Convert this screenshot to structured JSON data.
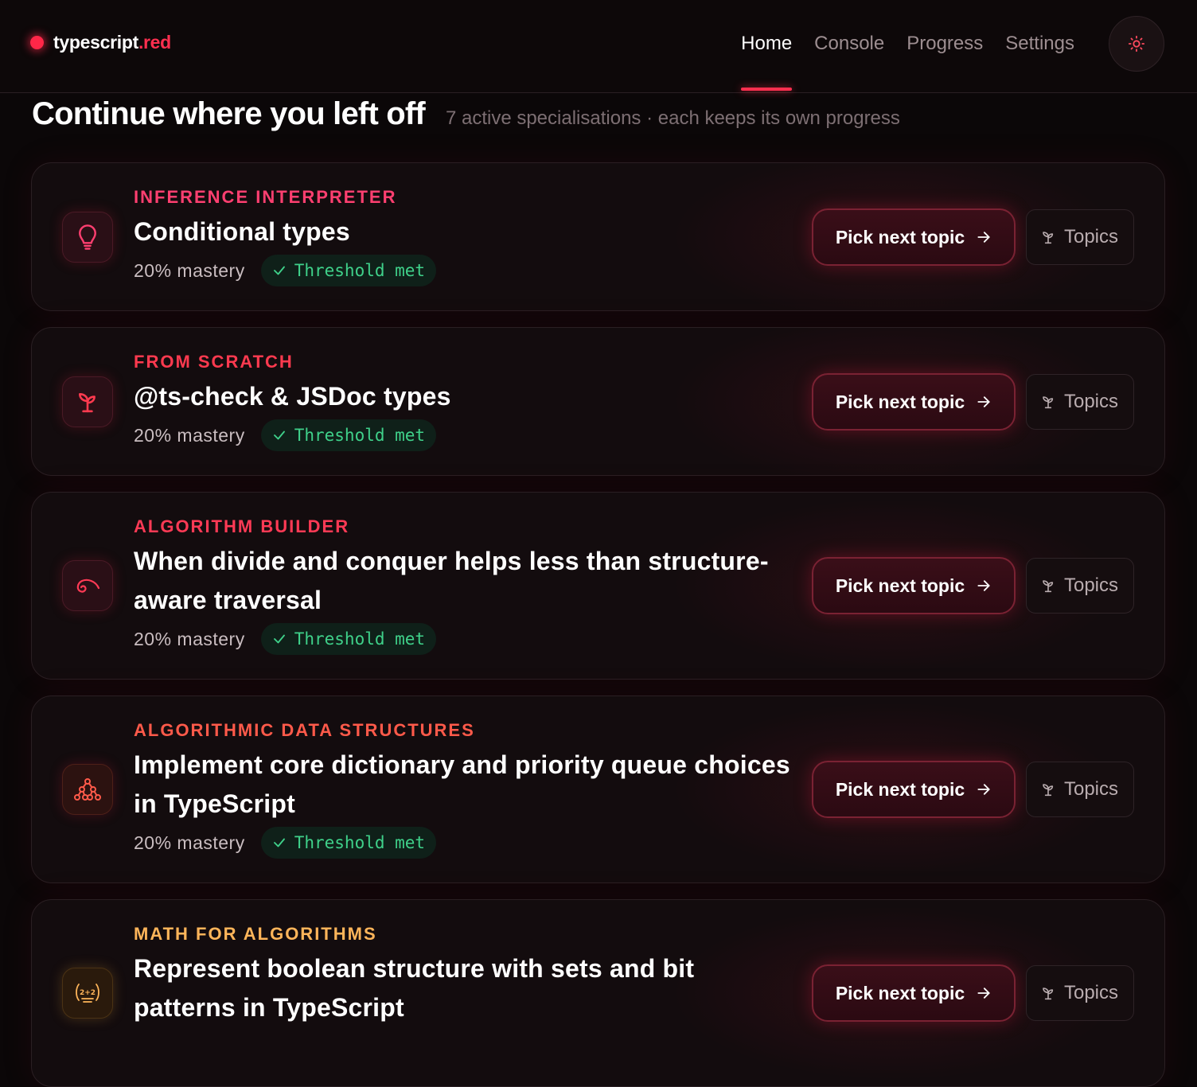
{
  "brand": {
    "name": "typescript",
    "tld": ".red"
  },
  "nav": [
    {
      "label": "Home",
      "active": true
    },
    {
      "label": "Console",
      "active": false
    },
    {
      "label": "Progress",
      "active": false
    },
    {
      "label": "Settings",
      "active": false
    }
  ],
  "theme_toggle": {
    "icon": "sun-icon"
  },
  "heading": {
    "title": "Continue where you left off",
    "subtitle": "7 active specialisations · each keeps its own progress"
  },
  "cards": [
    {
      "eyebrow": "Inference Interpreter",
      "eyebrow_color": "#ff3f70",
      "icon": "lightbulb-icon",
      "title": "Conditional types",
      "mastery": "20% mastery",
      "badge": "Threshold met",
      "pick_label": "Pick next topic",
      "topics_label": "Topics"
    },
    {
      "eyebrow": "From Scratch",
      "eyebrow_color": "#ff3a4f",
      "icon": "sprout-icon",
      "title": "@ts-check & JSDoc types",
      "mastery": "20% mastery",
      "badge": "Threshold met",
      "pick_label": "Pick next topic",
      "topics_label": "Topics"
    },
    {
      "eyebrow": "Algorithm Builder",
      "eyebrow_color": "#ff3a55",
      "icon": "spiral-icon",
      "title": "When divide and conquer helps less than structure-aware traversal",
      "mastery": "20% mastery",
      "badge": "Threshold met",
      "pick_label": "Pick next topic",
      "topics_label": "Topics"
    },
    {
      "eyebrow": "Algorithmic Data Structures",
      "eyebrow_color": "#ff5a4a",
      "icon": "tree-structure-icon",
      "title": "Implement core dictionary and priority queue choices in TypeScript",
      "mastery": "20% mastery",
      "badge": "Threshold met",
      "pick_label": "Pick next topic",
      "topics_label": "Topics"
    },
    {
      "eyebrow": "Math for Algorithms",
      "eyebrow_color": "#ffb55a",
      "icon": "math-icon",
      "title": "Represent boolean structure with sets and bit patterns in TypeScript",
      "mastery": "",
      "badge": "",
      "pick_label": "Pick next topic",
      "topics_label": "Topics"
    }
  ],
  "colors": {
    "accent": "#ff2f4f",
    "success": "#3fd18a",
    "background": "#0b0708"
  }
}
